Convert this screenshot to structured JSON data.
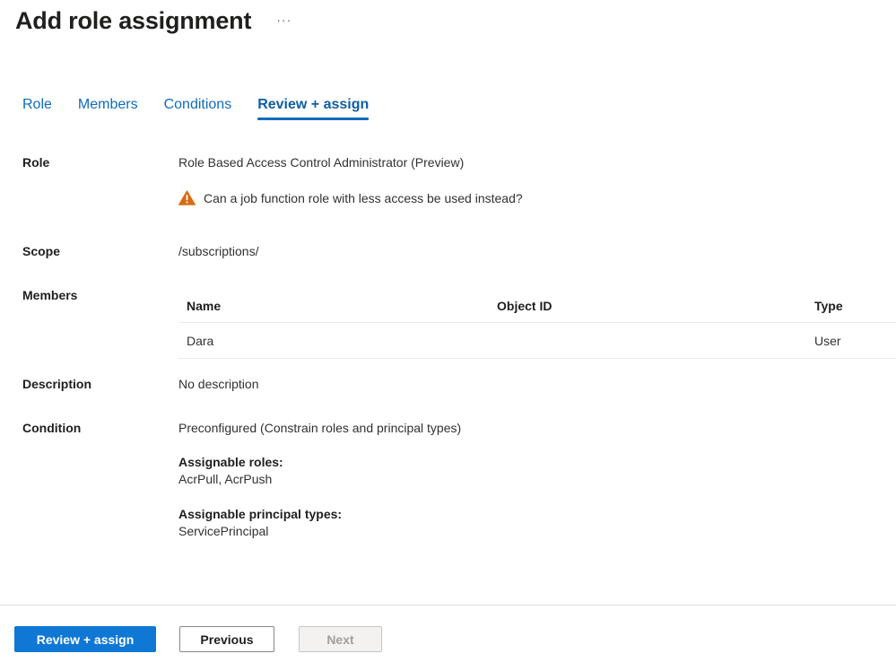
{
  "header": {
    "title": "Add role assignment",
    "more_label": "···"
  },
  "tabs": [
    {
      "label": "Role",
      "active": false
    },
    {
      "label": "Members",
      "active": false
    },
    {
      "label": "Conditions",
      "active": false
    },
    {
      "label": "Review + assign",
      "active": true
    }
  ],
  "summary": {
    "role": {
      "label": "Role",
      "value": "Role Based Access Control Administrator (Preview)",
      "warning": {
        "icon": "warning-triangle-icon",
        "text": "Can a job function role with less access be used instead?",
        "color": "#d86d10"
      }
    },
    "scope": {
      "label": "Scope",
      "value": "/subscriptions/"
    },
    "members": {
      "label": "Members",
      "columns": [
        "Name",
        "Object ID",
        "Type"
      ],
      "rows": [
        {
          "name": "Dara",
          "object_id": "",
          "type": "User"
        }
      ]
    },
    "description": {
      "label": "Description",
      "value": "No description"
    },
    "condition": {
      "label": "Condition",
      "value": "Preconfigured (Constrain roles and principal types)",
      "assignable_roles_label": "Assignable roles:",
      "assignable_roles_value": "AcrPull, AcrPush",
      "assignable_principal_types_label": "Assignable principal types:",
      "assignable_principal_types_value": "ServicePrincipal"
    }
  },
  "footer": {
    "review_assign_label": "Review + assign",
    "previous_label": "Previous",
    "next_label": "Next",
    "next_disabled": true,
    "primary_color": "#0f78d4"
  }
}
